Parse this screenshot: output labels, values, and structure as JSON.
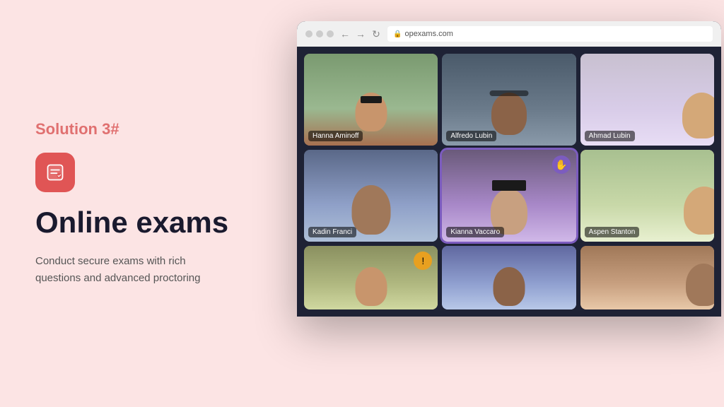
{
  "left": {
    "solution_label": "Solution 3#",
    "title": "Online exams",
    "description": "Conduct secure exams with rich\nquestions and advanced proctoring",
    "icon_alt": "exam-icon"
  },
  "browser": {
    "url": "opexams.com",
    "participants": [
      {
        "id": 1,
        "name": "Hanna Aminoff",
        "highlighted": false,
        "has_hand": false,
        "has_notification": false,
        "skin": 1
      },
      {
        "id": 2,
        "name": "Alfredo Lubin",
        "highlighted": false,
        "has_hand": false,
        "has_notification": false,
        "skin": 2
      },
      {
        "id": 3,
        "name": "Ahmad Lubin",
        "highlighted": false,
        "has_hand": false,
        "has_notification": false,
        "skin": 3,
        "partial": true
      },
      {
        "id": 4,
        "name": "Kadin Franci",
        "highlighted": false,
        "has_hand": false,
        "has_notification": false,
        "skin": 4
      },
      {
        "id": 5,
        "name": "Kianna Vaccaro",
        "highlighted": true,
        "has_hand": true,
        "has_notification": false,
        "skin": 5
      },
      {
        "id": 6,
        "name": "Aspen Stanton",
        "highlighted": false,
        "has_hand": false,
        "has_notification": false,
        "skin": 3,
        "partial": true
      },
      {
        "id": 7,
        "name": "",
        "highlighted": false,
        "has_hand": false,
        "has_notification": true,
        "skin": 1
      },
      {
        "id": 8,
        "name": "",
        "highlighted": false,
        "has_hand": false,
        "has_notification": false,
        "skin": 2
      },
      {
        "id": 9,
        "name": "",
        "highlighted": false,
        "has_hand": false,
        "has_notification": false,
        "skin": 4,
        "partial": true
      }
    ]
  },
  "colors": {
    "background": "#fce4e4",
    "solution_color": "#e07070",
    "icon_bg": "#e05555",
    "title_color": "#1a1a2e",
    "desc_color": "#555555",
    "browser_bg": "#1e2235",
    "highlight_color": "#7c5cbf"
  }
}
